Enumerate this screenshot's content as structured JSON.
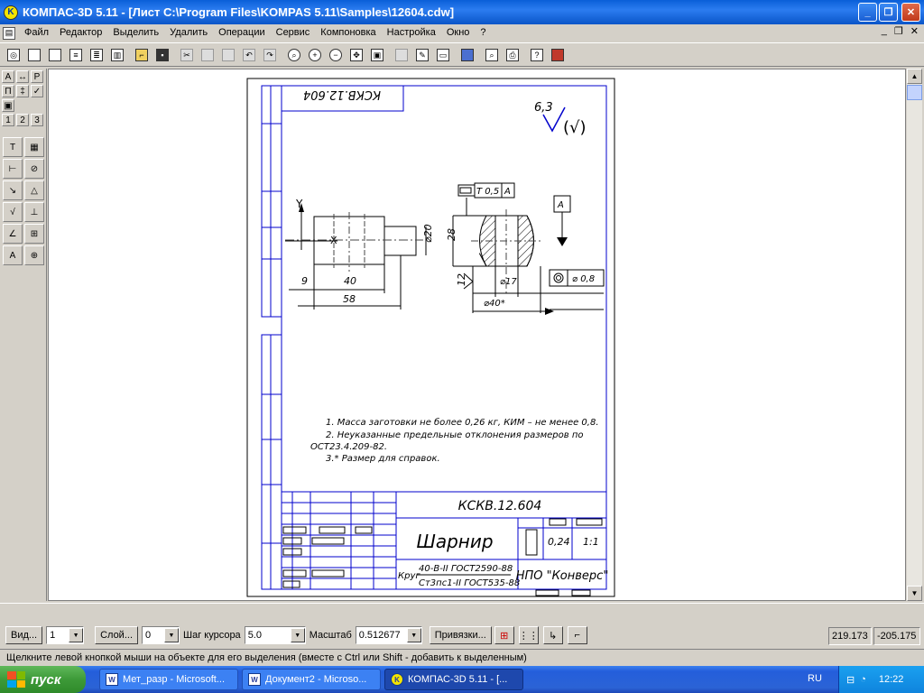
{
  "window": {
    "title": "КОМПАС-3D 5.11 - [Лист C:\\Program Files\\KOMPAS 5.11\\Samples\\12604.cdw]",
    "buttons": {
      "minimize": "_",
      "maximize": "❐",
      "close": "✕"
    }
  },
  "menu": {
    "items": [
      "Файл",
      "Редактор",
      "Выделить",
      "Удалить",
      "Операции",
      "Сервис",
      "Компоновка",
      "Настройка",
      "Окно",
      "?"
    ],
    "doc_buttons": [
      "_",
      "❐",
      "✕"
    ]
  },
  "toolbar": {
    "buttons": [
      "save-preview",
      "new-sheet",
      "new-fragment",
      "new-text",
      "new-spec",
      "print-preview",
      "open",
      "save",
      "cut",
      "copy",
      "paste",
      "undo",
      "redo",
      "zoom",
      "zoom-in",
      "zoom-out",
      "pan",
      "zoom-all",
      "refresh-1",
      "refresh-2",
      "grid-view",
      "manager",
      "page-print",
      "properties",
      "help",
      "exit"
    ]
  },
  "left_panel": {
    "tabs": [
      "Р",
      "1",
      "2",
      "3"
    ]
  },
  "drawing": {
    "stamp_doc": "КСКВ.12.604",
    "roughness_value": "6,3",
    "roughness_rest": "(√)",
    "axis_y": "Y",
    "axis_x": "X",
    "dims": {
      "d9": "9",
      "d40": "40",
      "d58": "58",
      "d20": "⌀20",
      "d28": "28",
      "d17": "⌀17",
      "d40s": "⌀40*",
      "d12": "12"
    },
    "tol_top": {
      "sym": "T",
      "val": "0,5",
      "base": "A"
    },
    "base_label": "A",
    "tol_bottom": {
      "val": "⌀ 0,8"
    },
    "notes": [
      "1. Масса заготовки не более 0,26 кг, КИМ – не менее 0,8.",
      "2. Неуказанные предельные отклонения размеров по",
      "ОСТ23.4.209-82.",
      "3.* Размер для справок."
    ],
    "title_block": {
      "doc": "КСКВ.12.604",
      "name": "Шарнир",
      "mass": "0,24",
      "scale": "1:1",
      "mat1": "40-В-II ГОСТ2590-88",
      "mat_prefix": "Круг",
      "mat2": "Ст3пс1-II ГОСТ535-88",
      "org": "НПО \"Конверс\""
    }
  },
  "status": {
    "view_label": "Вид...",
    "view_value": "1",
    "layer_label": "Слой...",
    "layer_value": "0",
    "step_label": "Шаг курсора",
    "step_value": "5.0",
    "scale_label": "Масштаб",
    "scale_value": "0.512677",
    "snap_label": "Привязки...",
    "coord_x": "219.173",
    "coord_y": "-205.175"
  },
  "hint": "Щелкните левой кнопкой мыши на объекте для его выделения (вместе с Ctrl или Shift - добавить к выделенным)",
  "taskbar": {
    "start": "пуск",
    "tasks": [
      "Мет_разр - Microsoft...",
      "Документ2 - Microso...",
      "КОМПАС-3D 5.11 - [..."
    ],
    "lang": "RU",
    "time": "12:22"
  }
}
